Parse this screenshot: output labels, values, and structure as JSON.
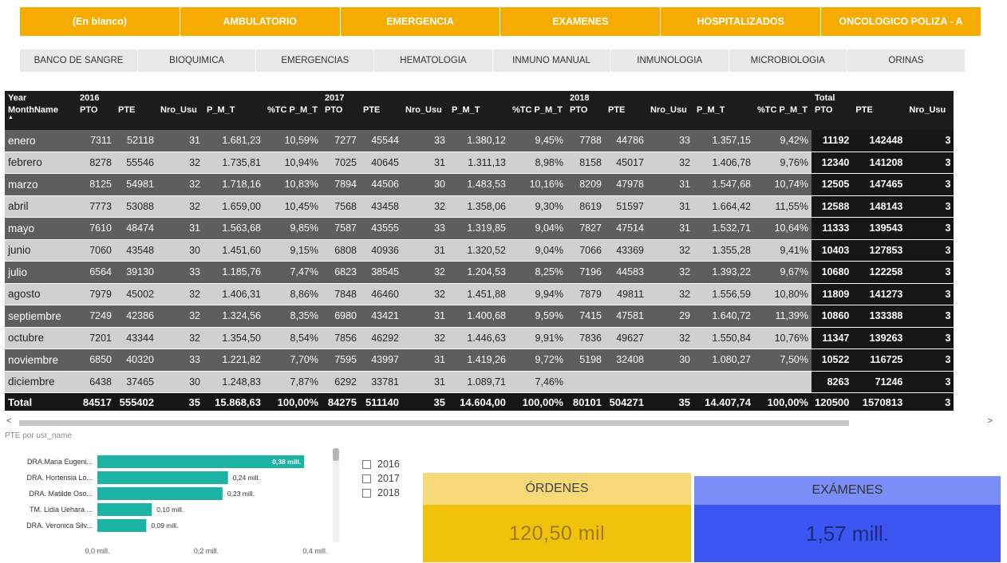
{
  "area_slicer": [
    "(En blanco)",
    "AMBULATORIO",
    "EMERGENCIA",
    "EXAMENES",
    "HOSPITALIZADOS",
    "ONCOLOGICO POLIZA - A"
  ],
  "section_slicer": [
    "BANCO DE SANGRE",
    "BIOQUIMICA",
    "EMERGENCIAS",
    "HEMATOLOGIA",
    "INMUNO MANUAL",
    "INMUNOLOGIA",
    "MICROBIOLOGIA",
    "ORINAS"
  ],
  "matrix": {
    "year_label": "Year",
    "month_label": "MonthName",
    "years": [
      "2016",
      "2017",
      "2018"
    ],
    "total_label": "Total",
    "measures": [
      "PTO",
      "PTE",
      "Nro_Usu",
      "P_M_T",
      "%TC P_M_T"
    ],
    "total_measures": [
      "PTO",
      "PTE",
      "Nro_Usu"
    ],
    "rows": [
      {
        "month": "enero",
        "y2016": [
          "7311",
          "52118",
          "31",
          "1.681,23",
          "10,59%"
        ],
        "y2017": [
          "7277",
          "45544",
          "33",
          "1.380,12",
          "9,45%"
        ],
        "y2018": [
          "7788",
          "44786",
          "33",
          "1.357,15",
          "9,42%"
        ],
        "total": [
          "11192",
          "142448",
          "3"
        ]
      },
      {
        "month": "febrero",
        "y2016": [
          "8278",
          "55546",
          "32",
          "1.735,81",
          "10,94%"
        ],
        "y2017": [
          "7025",
          "40645",
          "31",
          "1.311,13",
          "8,98%"
        ],
        "y2018": [
          "8158",
          "45017",
          "32",
          "1.406,78",
          "9,76%"
        ],
        "total": [
          "12340",
          "141208",
          "3"
        ]
      },
      {
        "month": "marzo",
        "y2016": [
          "8125",
          "54981",
          "32",
          "1.718,16",
          "10,83%"
        ],
        "y2017": [
          "7894",
          "44506",
          "30",
          "1.483,53",
          "10,16%"
        ],
        "y2018": [
          "8209",
          "47978",
          "31",
          "1.547,68",
          "10,74%"
        ],
        "total": [
          "12505",
          "147465",
          "3"
        ]
      },
      {
        "month": "abril",
        "y2016": [
          "7773",
          "53088",
          "32",
          "1.659,00",
          "10,45%"
        ],
        "y2017": [
          "7568",
          "43458",
          "32",
          "1.358,06",
          "9,30%"
        ],
        "y2018": [
          "8619",
          "51597",
          "31",
          "1.664,42",
          "11,55%"
        ],
        "total": [
          "12588",
          "148143",
          "3"
        ]
      },
      {
        "month": "mayo",
        "y2016": [
          "7610",
          "48474",
          "31",
          "1.563,68",
          "9,85%"
        ],
        "y2017": [
          "7587",
          "43555",
          "33",
          "1.319,85",
          "9,04%"
        ],
        "y2018": [
          "7827",
          "47514",
          "31",
          "1.532,71",
          "10,64%"
        ],
        "total": [
          "11333",
          "139543",
          "3"
        ]
      },
      {
        "month": "junio",
        "y2016": [
          "7060",
          "43548",
          "30",
          "1.451,60",
          "9,15%"
        ],
        "y2017": [
          "6808",
          "40936",
          "31",
          "1.320,52",
          "9,04%"
        ],
        "y2018": [
          "7066",
          "43369",
          "32",
          "1.355,28",
          "9,41%"
        ],
        "total": [
          "10403",
          "127853",
          "3"
        ]
      },
      {
        "month": "julio",
        "y2016": [
          "6564",
          "39130",
          "33",
          "1.185,76",
          "7,47%"
        ],
        "y2017": [
          "6823",
          "38545",
          "32",
          "1.204,53",
          "8,25%"
        ],
        "y2018": [
          "7196",
          "44583",
          "32",
          "1.393,22",
          "9,67%"
        ],
        "total": [
          "10680",
          "122258",
          "3"
        ]
      },
      {
        "month": "agosto",
        "y2016": [
          "7979",
          "45002",
          "32",
          "1.406,31",
          "8,86%"
        ],
        "y2017": [
          "7848",
          "46460",
          "32",
          "1.451,88",
          "9,94%"
        ],
        "y2018": [
          "7879",
          "49811",
          "32",
          "1.556,59",
          "10,80%"
        ],
        "total": [
          "11809",
          "141273",
          "3"
        ]
      },
      {
        "month": "septiembre",
        "y2016": [
          "7249",
          "42386",
          "32",
          "1.324,56",
          "8,35%"
        ],
        "y2017": [
          "6980",
          "43421",
          "31",
          "1.400,68",
          "9,59%"
        ],
        "y2018": [
          "7415",
          "47581",
          "29",
          "1.640,72",
          "11,39%"
        ],
        "total": [
          "10860",
          "133388",
          "3"
        ]
      },
      {
        "month": "octubre",
        "y2016": [
          "7201",
          "43344",
          "32",
          "1.354,50",
          "8,54%"
        ],
        "y2017": [
          "7856",
          "46292",
          "32",
          "1.446,63",
          "9,91%"
        ],
        "y2018": [
          "7836",
          "49627",
          "32",
          "1.550,84",
          "10,76%"
        ],
        "total": [
          "11347",
          "139263",
          "3"
        ]
      },
      {
        "month": "noviembre",
        "y2016": [
          "6850",
          "40320",
          "33",
          "1.221,82",
          "7,70%"
        ],
        "y2017": [
          "7595",
          "43997",
          "31",
          "1.419,26",
          "9,72%"
        ],
        "y2018": [
          "5198",
          "32408",
          "30",
          "1.080,27",
          "7,50%"
        ],
        "total": [
          "10522",
          "116725",
          "3"
        ]
      },
      {
        "month": "diciembre",
        "y2016": [
          "6438",
          "37465",
          "30",
          "1.248,83",
          "7,87%"
        ],
        "y2017": [
          "6292",
          "33781",
          "31",
          "1.089,71",
          "7,46%"
        ],
        "y2018": [
          "",
          "",
          "",
          "",
          ""
        ],
        "total": [
          "8263",
          "71246",
          "3"
        ]
      }
    ],
    "totals_row": {
      "label": "Total",
      "y2016": [
        "84517",
        "555402",
        "35",
        "15.868,63",
        "100,00%"
      ],
      "y2017": [
        "84275",
        "511140",
        "35",
        "14.604,00",
        "100,00%"
      ],
      "y2018": [
        "80101",
        "504271",
        "35",
        "14.407,74",
        "100,00%"
      ],
      "total": [
        "120500",
        "1570813",
        "3"
      ]
    }
  },
  "scroll": {
    "left_arrow": "<",
    "right_arrow": ">"
  },
  "bar_chart_title": "PTE por usr_name",
  "chart_data": {
    "type": "bar",
    "orientation": "horizontal",
    "categories": [
      "DRA.Maria Eugeni...",
      "DRA. Hortensia Lo...",
      "DRA. Matilde Oso...",
      "TM. Lidia Uehara ...",
      "DRA. Veronica Silv..."
    ],
    "values": [
      0.38,
      0.24,
      0.23,
      0.1,
      0.09
    ],
    "data_labels": [
      "0,38 mill.",
      "0,24 mill.",
      "0,23 mill.",
      "0,10 mill.",
      "0,09 mill."
    ],
    "xticks": [
      "0,0 mill.",
      "0,2 mill.",
      "0,4 mill."
    ],
    "xlim": [
      0,
      0.4
    ],
    "bar_color": "#1cb3a4"
  },
  "year_filter": [
    "2016",
    "2017",
    "2018"
  ],
  "card_ordenes": {
    "label": "ÓRDENES",
    "value": "120,50 mil"
  },
  "card_examenes": {
    "label": "EXÁMENES",
    "value": "1,57 mill."
  },
  "colors": {
    "orange": "#f5ab00",
    "teal": "#1cb3a4",
    "yellow": "#f0c20c",
    "blue": "#3c54f0"
  }
}
